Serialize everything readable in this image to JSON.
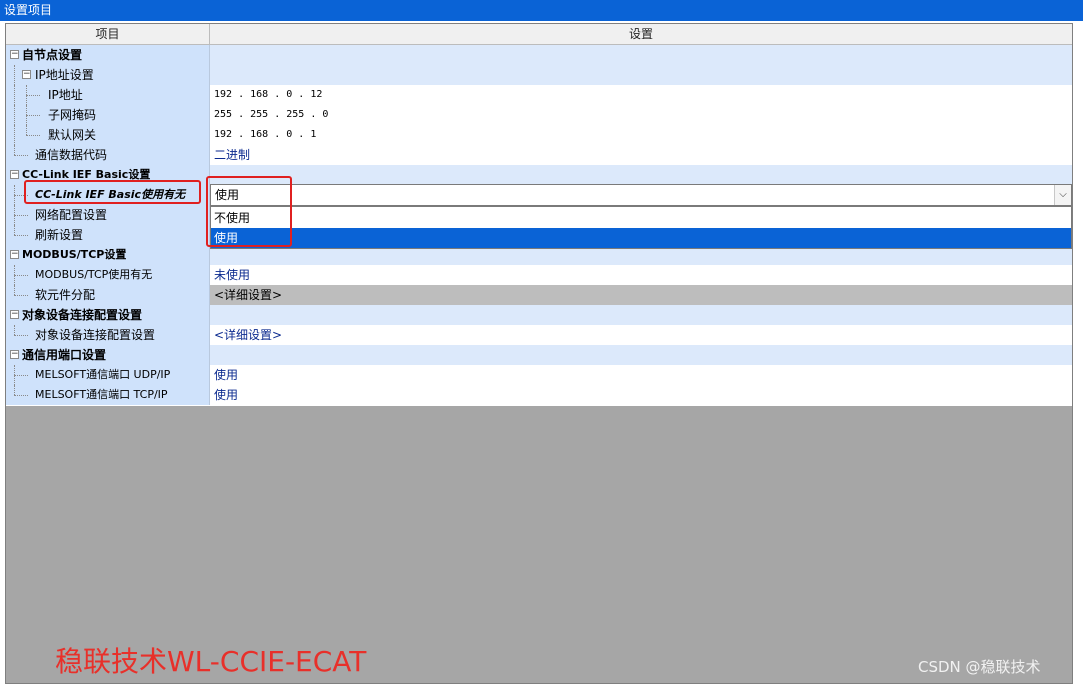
{
  "window": {
    "title": "设置项目"
  },
  "header": {
    "item": "项目",
    "setting": "设置"
  },
  "rows": [
    {
      "label": "自节点设置",
      "value": ""
    },
    {
      "label": "IP地址设置",
      "value": ""
    },
    {
      "label": "IP地址",
      "value": "192 .  168 .    0 .   12"
    },
    {
      "label": "子网掩码",
      "value": "255 .  255 .  255 .    0"
    },
    {
      "label": "默认网关",
      "value": "192 .  168 .    0 .    1"
    },
    {
      "label": "通信数据代码",
      "value": "二进制"
    },
    {
      "label": "CC-Link IEF Basic设置",
      "value": ""
    },
    {
      "label": "CC-Link IEF Basic使用有无",
      "value": "使用"
    },
    {
      "label": "网络配置设置",
      "value": ""
    },
    {
      "label": "刷新设置",
      "value": ""
    },
    {
      "label": "MODBUS/TCP设置",
      "value": ""
    },
    {
      "label": "MODBUS/TCP使用有无",
      "value": "未使用"
    },
    {
      "label": "软元件分配",
      "value": "<详细设置>"
    },
    {
      "label": "对象设备连接配置设置",
      "value": ""
    },
    {
      "label": "对象设备连接配置设置",
      "value": "<详细设置>"
    },
    {
      "label": "通信用端口设置",
      "value": ""
    },
    {
      "label": "MELSOFT通信端口 UDP/IP",
      "value": "使用"
    },
    {
      "label": "MELSOFT通信端口 TCP/IP",
      "value": "使用"
    }
  ],
  "dropdown": {
    "current": "使用",
    "options": [
      "不使用",
      "使用"
    ],
    "selected_index": 1
  },
  "watermark": "稳联技术WL-CCIE-ECAT",
  "credit": "CSDN @稳联技术",
  "colors": {
    "accent": "#0a63d6",
    "highlight": "#e02020",
    "label_bg": "#cfe2fb"
  }
}
